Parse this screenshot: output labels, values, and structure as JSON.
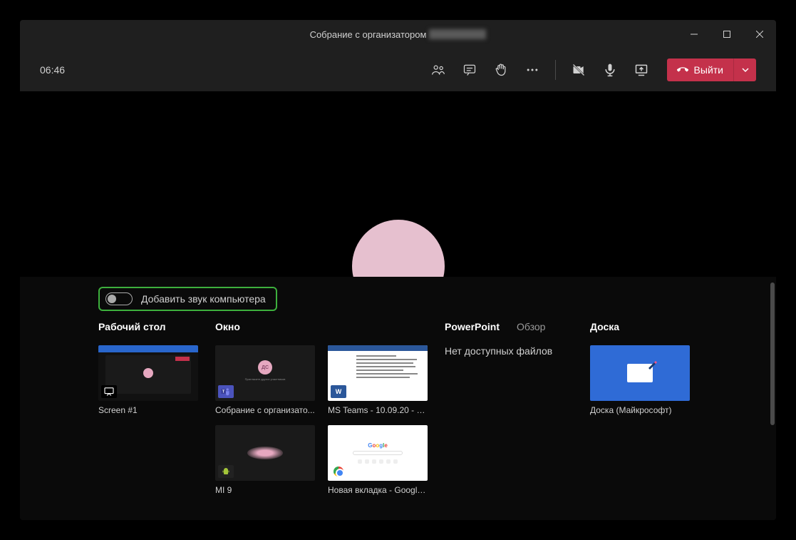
{
  "titlebar": {
    "title": "Собрание с организатором"
  },
  "toolbar": {
    "timer": "06:46",
    "leave_label": "Выйти"
  },
  "share_tray": {
    "audio_toggle_label": "Добавить звук компьютера",
    "sections": {
      "desktop": {
        "header": "Рабочий стол",
        "items": [
          "Screen #1"
        ]
      },
      "window": {
        "header": "Окно",
        "items": [
          "Собрание с организато...",
          "MS Teams - 10.09.20 - 1...",
          "MI 9",
          "Новая вкладка - Google..."
        ]
      },
      "powerpoint": {
        "header": "PowerPoint",
        "secondary": "Обзор",
        "empty_text": "Нет доступных файлов"
      },
      "whiteboard": {
        "header": "Доска",
        "items": [
          "Доска (Майкрософт)"
        ]
      }
    }
  },
  "avatar_initials": "ДС"
}
